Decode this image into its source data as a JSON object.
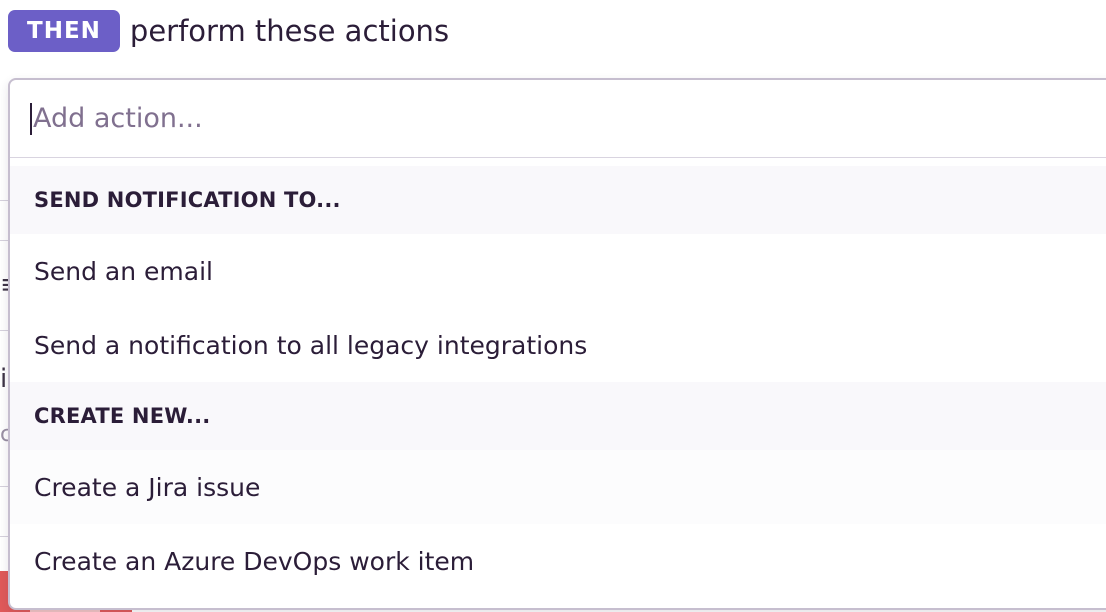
{
  "header": {
    "badge": "THEN",
    "text": "perform these actions"
  },
  "search": {
    "value": "",
    "placeholder": "Add action..."
  },
  "groups": [
    {
      "label": "SEND NOTIFICATION TO...",
      "options": [
        "Send an email",
        "Send a notification to all legacy integrations"
      ]
    },
    {
      "label": "CREATE NEW...",
      "options": [
        "Create a Jira issue",
        "Create an Azure DevOps work item"
      ]
    }
  ],
  "colors": {
    "badge": "#6c5fc7",
    "text": "#2b1d38",
    "placeholder": "#80708f",
    "group_bg": "#f9f8fb",
    "border": "#c6becf"
  }
}
